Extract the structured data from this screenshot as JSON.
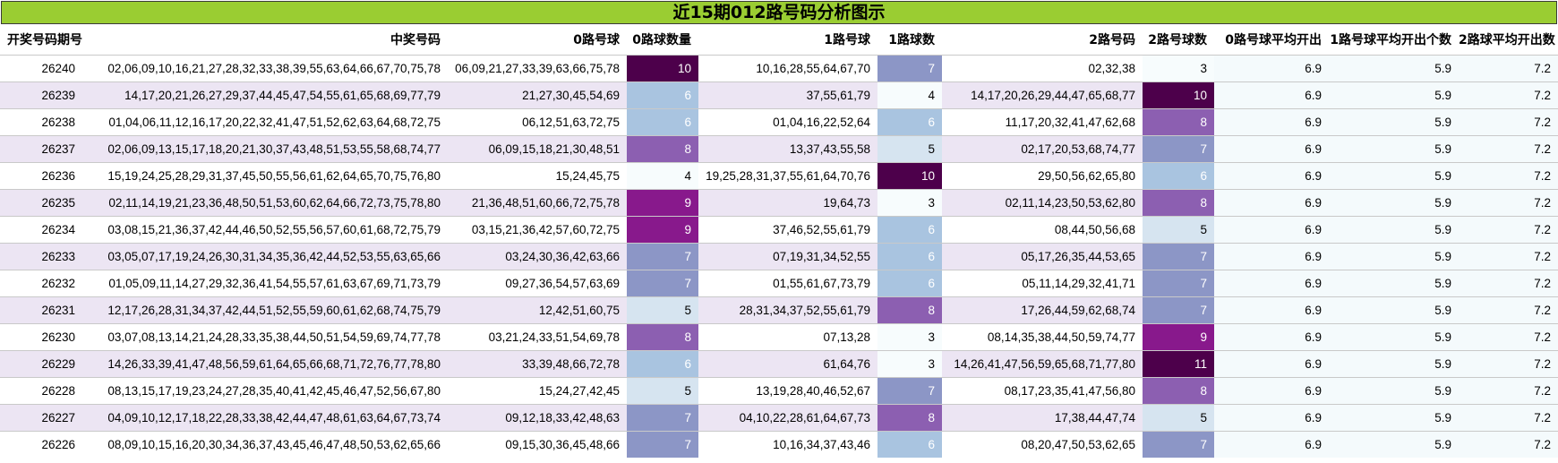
{
  "title": "近15期012路号码分析图示",
  "headers": [
    "开奖号码期号",
    "中奖号码",
    "0路号球",
    "0路球数量",
    "1路号球",
    "1路球数",
    "2路号码",
    "2路号球数",
    "0路号球平均开出",
    "1路号球平均开出个数",
    "2路球平均开出数"
  ],
  "rows": [
    {
      "issue": "26240",
      "numbers": "02,06,09,10,16,21,27,28,32,33,38,39,55,63,64,66,67,70,75,78",
      "r0": "06,09,21,27,33,39,63,66,75,78",
      "c0": "10",
      "r1": "10,16,28,55,64,67,70",
      "c1": "7",
      "r2": "02,32,38",
      "c2": "3",
      "a0": "6.9",
      "a1": "5.9",
      "a2": "7.2"
    },
    {
      "issue": "26239",
      "numbers": "14,17,20,21,26,27,29,37,44,45,47,54,55,61,65,68,69,77,79",
      "r0": "21,27,30,45,54,69",
      "c0": "6",
      "r1": "37,55,61,79",
      "c1": "4",
      "r2": "14,17,20,26,29,44,47,65,68,77",
      "c2": "10",
      "a0": "6.9",
      "a1": "5.9",
      "a2": "7.2"
    },
    {
      "issue": "26238",
      "numbers": "01,04,06,11,12,16,17,20,22,32,41,47,51,52,62,63,64,68,72,75",
      "r0": "06,12,51,63,72,75",
      "c0": "6",
      "r1": "01,04,16,22,52,64",
      "c1": "6",
      "r2": "11,17,20,32,41,47,62,68",
      "c2": "8",
      "a0": "6.9",
      "a1": "5.9",
      "a2": "7.2"
    },
    {
      "issue": "26237",
      "numbers": "02,06,09,13,15,17,18,20,21,30,37,43,48,51,53,55,58,68,74,77",
      "r0": "06,09,15,18,21,30,48,51",
      "c0": "8",
      "r1": "13,37,43,55,58",
      "c1": "5",
      "r2": "02,17,20,53,68,74,77",
      "c2": "7",
      "a0": "6.9",
      "a1": "5.9",
      "a2": "7.2"
    },
    {
      "issue": "26236",
      "numbers": "15,19,24,25,28,29,31,37,45,50,55,56,61,62,64,65,70,75,76,80",
      "r0": "15,24,45,75",
      "c0": "4",
      "r1": "19,25,28,31,37,55,61,64,70,76",
      "c1": "10",
      "r2": "29,50,56,62,65,80",
      "c2": "6",
      "a0": "6.9",
      "a1": "5.9",
      "a2": "7.2"
    },
    {
      "issue": "26235",
      "numbers": "02,11,14,19,21,23,36,48,50,51,53,60,62,64,66,72,73,75,78,80",
      "r0": "21,36,48,51,60,66,72,75,78",
      "c0": "9",
      "r1": "19,64,73",
      "c1": "3",
      "r2": "02,11,14,23,50,53,62,80",
      "c2": "8",
      "a0": "6.9",
      "a1": "5.9",
      "a2": "7.2"
    },
    {
      "issue": "26234",
      "numbers": "03,08,15,21,36,37,42,44,46,50,52,55,56,57,60,61,68,72,75,79",
      "r0": "03,15,21,36,42,57,60,72,75",
      "c0": "9",
      "r1": "37,46,52,55,61,79",
      "c1": "6",
      "r2": "08,44,50,56,68",
      "c2": "5",
      "a0": "6.9",
      "a1": "5.9",
      "a2": "7.2"
    },
    {
      "issue": "26233",
      "numbers": "03,05,07,17,19,24,26,30,31,34,35,36,42,44,52,53,55,63,65,66",
      "r0": "03,24,30,36,42,63,66",
      "c0": "7",
      "r1": "07,19,31,34,52,55",
      "c1": "6",
      "r2": "05,17,26,35,44,53,65",
      "c2": "7",
      "a0": "6.9",
      "a1": "5.9",
      "a2": "7.2"
    },
    {
      "issue": "26232",
      "numbers": "01,05,09,11,14,27,29,32,36,41,54,55,57,61,63,67,69,71,73,79",
      "r0": "09,27,36,54,57,63,69",
      "c0": "7",
      "r1": "01,55,61,67,73,79",
      "c1": "6",
      "r2": "05,11,14,29,32,41,71",
      "c2": "7",
      "a0": "6.9",
      "a1": "5.9",
      "a2": "7.2"
    },
    {
      "issue": "26231",
      "numbers": "12,17,26,28,31,34,37,42,44,51,52,55,59,60,61,62,68,74,75,79",
      "r0": "12,42,51,60,75",
      "c0": "5",
      "r1": "28,31,34,37,52,55,61,79",
      "c1": "8",
      "r2": "17,26,44,59,62,68,74",
      "c2": "7",
      "a0": "6.9",
      "a1": "5.9",
      "a2": "7.2"
    },
    {
      "issue": "26230",
      "numbers": "03,07,08,13,14,21,24,28,33,35,38,44,50,51,54,59,69,74,77,78",
      "r0": "03,21,24,33,51,54,69,78",
      "c0": "8",
      "r1": "07,13,28",
      "c1": "3",
      "r2": "08,14,35,38,44,50,59,74,77",
      "c2": "9",
      "a0": "6.9",
      "a1": "5.9",
      "a2": "7.2"
    },
    {
      "issue": "26229",
      "numbers": "14,26,33,39,41,47,48,56,59,61,64,65,66,68,71,72,76,77,78,80",
      "r0": "33,39,48,66,72,78",
      "c0": "6",
      "r1": "61,64,76",
      "c1": "3",
      "r2": "14,26,41,47,56,59,65,68,71,77,80",
      "c2": "11",
      "a0": "6.9",
      "a1": "5.9",
      "a2": "7.2"
    },
    {
      "issue": "26228",
      "numbers": "08,13,15,17,19,23,24,27,28,35,40,41,42,45,46,47,52,56,67,80",
      "r0": "15,24,27,42,45",
      "c0": "5",
      "r1": "13,19,28,40,46,52,67",
      "c1": "7",
      "r2": "08,17,23,35,41,47,56,80",
      "c2": "8",
      "a0": "6.9",
      "a1": "5.9",
      "a2": "7.2"
    },
    {
      "issue": "26227",
      "numbers": "04,09,10,12,17,18,22,28,33,38,42,44,47,48,61,63,64,67,73,74",
      "r0": "09,12,18,33,42,48,63",
      "c0": "7",
      "r1": "04,10,22,28,61,64,67,73",
      "c1": "8",
      "r2": "17,38,44,47,74",
      "c2": "5",
      "a0": "6.9",
      "a1": "5.9",
      "a2": "7.2"
    },
    {
      "issue": "26226",
      "numbers": "08,09,10,15,16,20,30,34,36,37,43,45,46,47,48,50,53,62,65,66",
      "r0": "09,15,30,36,45,48,66",
      "c0": "7",
      "r1": "10,16,34,37,43,46",
      "c1": "6",
      "r2": "08,20,47,50,53,62,65",
      "c2": "7",
      "a0": "6.9",
      "a1": "5.9",
      "a2": "7.2"
    }
  ],
  "colors": {
    "title_bg": "#9acd32",
    "band": "#ece5f3",
    "scale": {
      "3": "#f7fcfd",
      "4": "#f7fcfd",
      "5": "#d6e4f0",
      "6": "#a9c4e0",
      "7": "#8c96c6",
      "8": "#8c5fb1",
      "9": "#88198c",
      "10": "#4d004b",
      "11": "#4d004b"
    }
  }
}
